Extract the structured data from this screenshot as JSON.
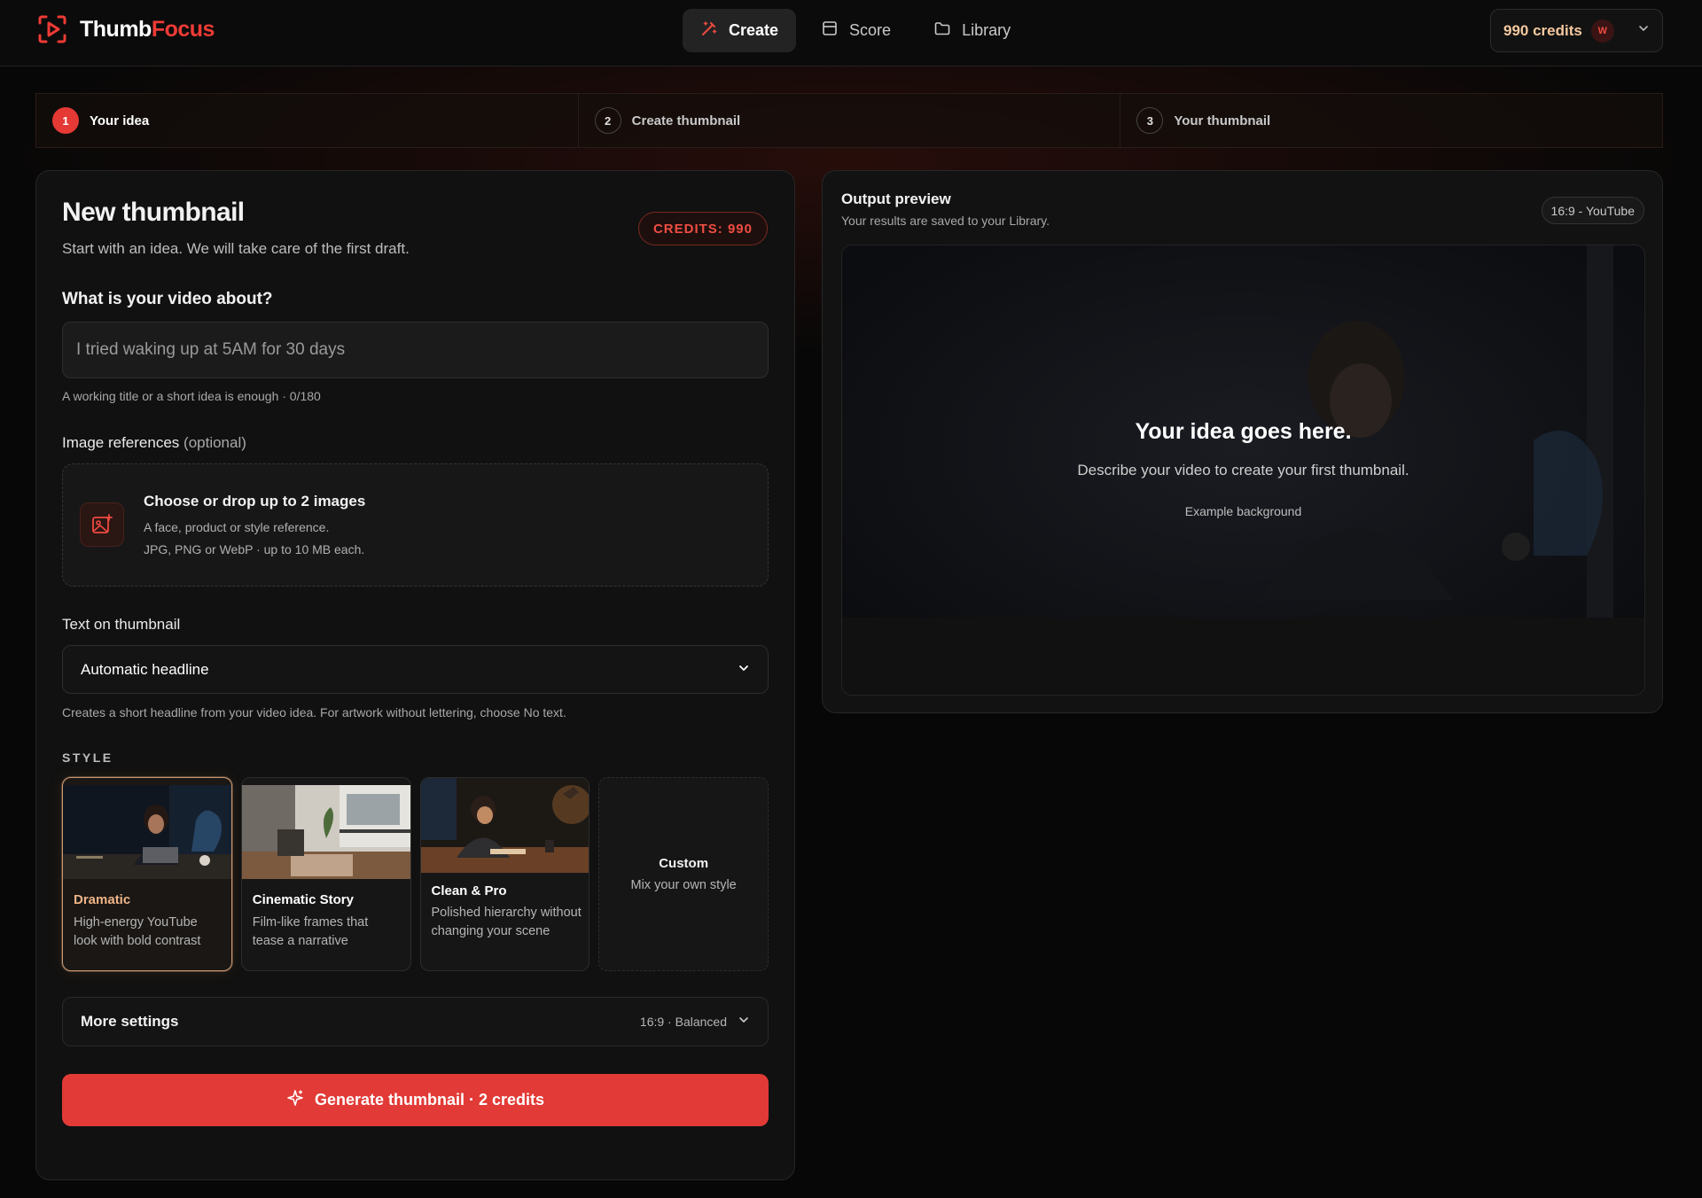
{
  "brand": {
    "name_part1": "Thumb",
    "name_part2": "Focus",
    "accent": "#ef3b36"
  },
  "nav": {
    "items": [
      {
        "label": "Create",
        "icon": "magic-wand-icon",
        "active": true
      },
      {
        "label": "Score",
        "icon": "score-panel-icon",
        "active": false
      },
      {
        "label": "Library",
        "icon": "folder-icon",
        "active": false
      }
    ]
  },
  "account": {
    "credits_label": "990 credits",
    "avatar_initial": "W"
  },
  "stepper": {
    "steps": [
      {
        "num": "1",
        "label": "Your idea",
        "active": true
      },
      {
        "num": "2",
        "label": "Create thumbnail",
        "active": false
      },
      {
        "num": "3",
        "label": "Your thumbnail",
        "active": false
      }
    ]
  },
  "form": {
    "title": "New thumbnail",
    "subtitle": "Start with an idea. We will take care of the first draft.",
    "credits_badge": "CREDITS: 990",
    "idea_label": "What is your video about?",
    "idea_placeholder": "I tried waking up at 5AM for 30 days",
    "idea_value": "",
    "idea_helper": "A working title or a short idea is enough · 0/180",
    "refs_label": "Image references",
    "refs_optional": "(optional)",
    "dropzone": {
      "title": "Choose or drop up to 2 images",
      "line1": "A face, product or style reference.",
      "line2": "JPG, PNG or WebP · up to 10 MB each."
    },
    "text_label": "Text on thumbnail",
    "text_selected": "Automatic headline",
    "text_helper": "Creates a short headline from your video idea. For artwork without lettering, choose No text.",
    "style_label": "STYLE",
    "styles": [
      {
        "name": "Dramatic",
        "desc": "High-energy YouTube look with bold contrast",
        "selected": true
      },
      {
        "name": "Cinematic Story",
        "desc": "Film-like frames that tease a narrative",
        "selected": false
      },
      {
        "name": "Clean & Pro",
        "desc": "Polished hierarchy without changing your scene",
        "selected": false
      },
      {
        "name": "Custom",
        "desc": "Mix your own style",
        "selected": false
      }
    ],
    "more_settings": {
      "label": "More settings",
      "value": "16:9 · Balanced"
    },
    "generate_label": "Generate thumbnail · 2 credits"
  },
  "preview": {
    "title": "Output preview",
    "subtitle": "Your results are saved to your Library.",
    "ratio": "16:9 - YouTube",
    "headline": "Your idea goes here.",
    "description": "Describe your video to create your first thumbnail.",
    "note": "Example background"
  }
}
